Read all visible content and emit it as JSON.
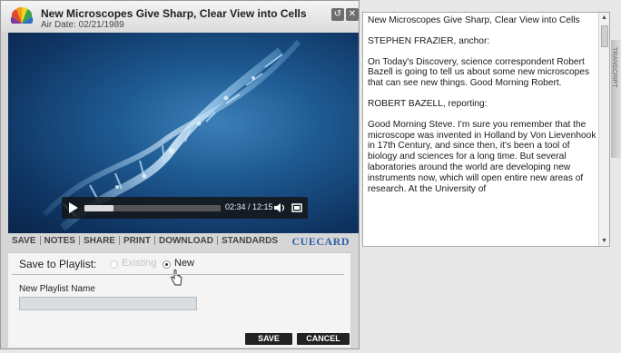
{
  "header": {
    "title": "New Microscopes Give Sharp, Clear View into Cells",
    "air_date": "Air Date: 02/21/1989"
  },
  "video": {
    "time": "02:34 / 12:15",
    "progress": 0.21
  },
  "toolbar": {
    "items": [
      "SAVE",
      "NOTES",
      "SHARE",
      "PRINT",
      "DOWNLOAD",
      "STANDARDS"
    ],
    "brand": "CUECARD"
  },
  "save_panel": {
    "label": "Save to Playlist:",
    "option_existing": "Existing",
    "option_new": "New",
    "selected": "New",
    "name_label": "New Playlist Name",
    "name_value": "",
    "save_button": "SAVE",
    "cancel_button": "CANCEL"
  },
  "transcript": {
    "side_tab": "TRANSCRIPT",
    "paragraphs": [
      "New Microscopes Give Sharp, Clear View into Cells",
      "STEPHEN FRAZIER, anchor:",
      "On Today's Discovery, science correspondent Robert Bazell is going to tell us about some new microscopes that can see new things. Good Morning Robert.",
      "ROBERT BAZELL, reporting:",
      "Good Morning Steve. I'm sure you remember that the microscope was invented in Holland by Von Lievenhook in 17th Century, and since then, it's been a tool of biology and sciences for a long time. But several laboratories around the world are developing new instruments now, which will open entire new areas of research. At the University of"
    ]
  },
  "colors": {
    "accent": "#2e62a8",
    "button_bg": "#222222"
  }
}
